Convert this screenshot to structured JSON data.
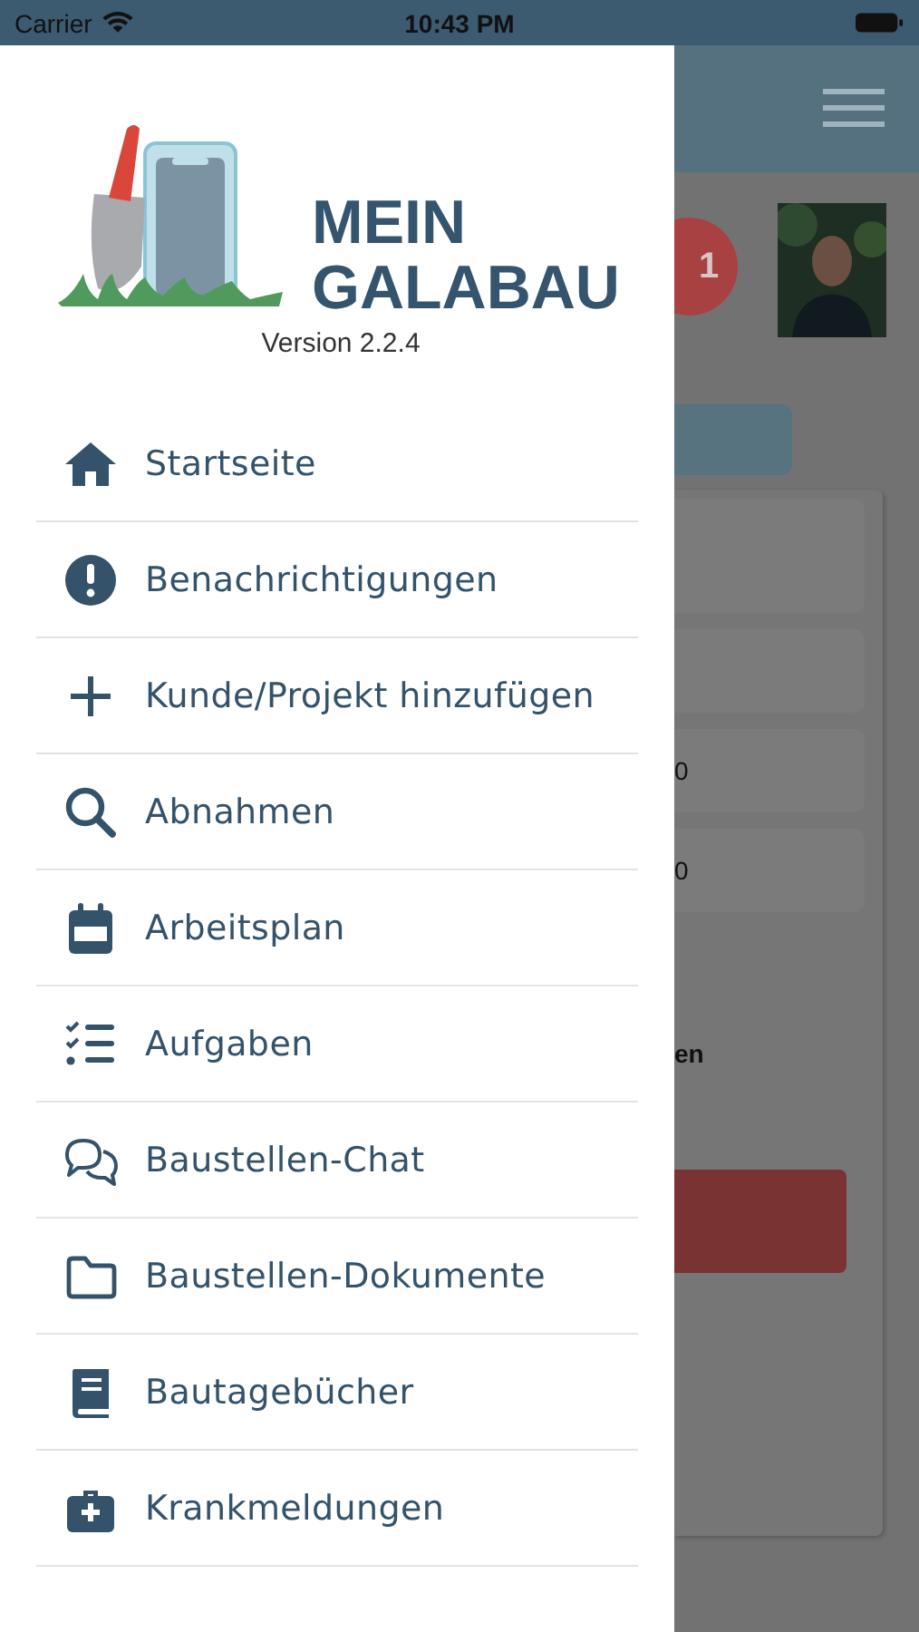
{
  "status_bar": {
    "carrier": "Carrier",
    "time": "10:43 PM"
  },
  "drawer": {
    "logo_lines": [
      "MEIN",
      "GALABAU"
    ],
    "version": "Version 2.2.4",
    "items": [
      {
        "label": "Startseite"
      },
      {
        "label": "Benachrichtigungen"
      },
      {
        "label": "Kunde/Projekt hinzufügen"
      },
      {
        "label": "Abnahmen"
      },
      {
        "label": "Arbeitsplan"
      },
      {
        "label": "Aufgaben"
      },
      {
        "label": "Baustellen-Chat"
      },
      {
        "label": "Baustellen-Dokumente"
      },
      {
        "label": "Bautagebücher"
      },
      {
        "label": "Krankmeldungen"
      }
    ]
  },
  "background_page": {
    "badge": "1",
    "field_fragments": [
      "0",
      "0"
    ],
    "text_fragment": "en"
  }
}
